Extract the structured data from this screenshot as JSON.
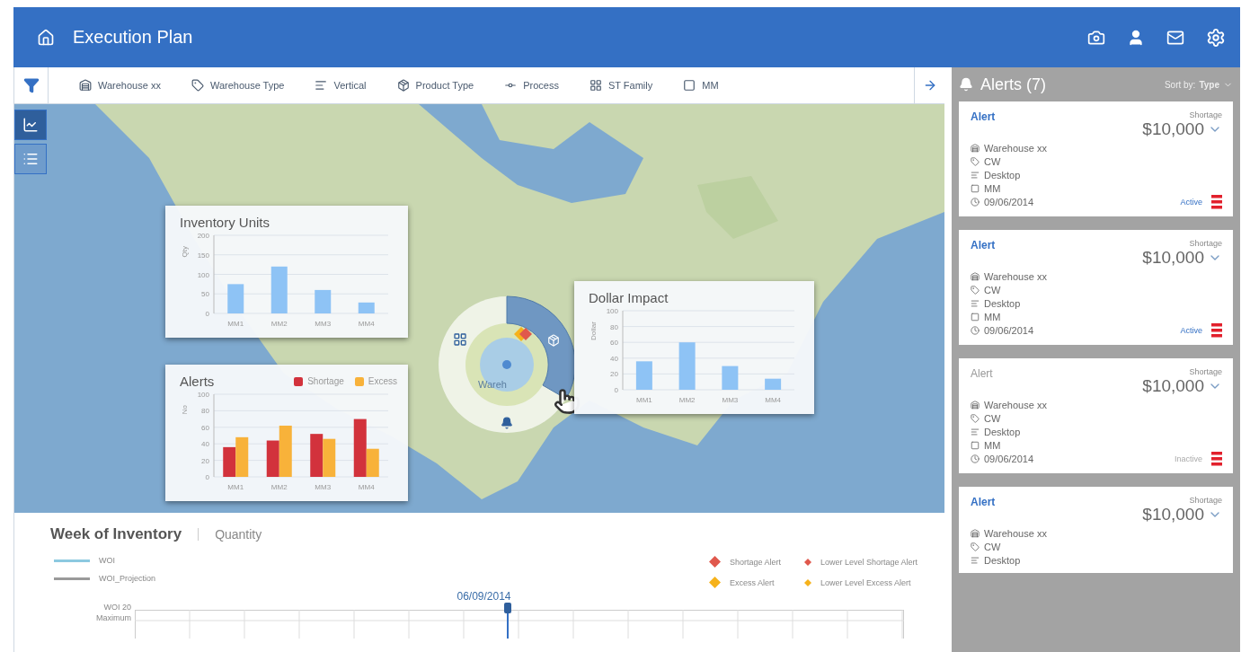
{
  "header": {
    "title": "Execution Plan"
  },
  "filters": [
    {
      "kind": "warehouse",
      "label": "Warehouse xx"
    },
    {
      "kind": "type",
      "label": "Warehouse Type"
    },
    {
      "kind": "vertical",
      "label": "Vertical"
    },
    {
      "kind": "product",
      "label": "Product Type"
    },
    {
      "kind": "process",
      "label": "Process"
    },
    {
      "kind": "family",
      "label": "ST Family"
    },
    {
      "kind": "mm",
      "label": "MM"
    }
  ],
  "view_tools": [
    {
      "kind": "chart",
      "selected": true
    },
    {
      "kind": "list",
      "selected": false
    }
  ],
  "map": {
    "radial_label": "Wareh",
    "inventory": {
      "chart_data": {
        "type": "bar",
        "title": "Inventory Units",
        "ylabel": "Qty",
        "categories": [
          "MM1",
          "MM2",
          "MM3",
          "MM4"
        ],
        "series": [
          {
            "color": "#8ec3f5",
            "values": [
              75,
              120,
              60,
              28
            ]
          }
        ],
        "grid": true,
        "ylim": [
          0,
          200
        ],
        "yticks": [
          0,
          50,
          100,
          150,
          200
        ]
      }
    },
    "alerts": {
      "chart_data": {
        "type": "bar",
        "title": "Alerts",
        "ylabel": "No",
        "categories": [
          "MM1",
          "MM2",
          "MM3",
          "MM4"
        ],
        "series": [
          {
            "name": "Shortage",
            "color": "#d2323c",
            "values": [
              36,
              44,
              52,
              70
            ]
          },
          {
            "name": "Excess",
            "color": "#f8b23a",
            "values": [
              48,
              62,
              46,
              34
            ]
          }
        ],
        "grid": true,
        "ylim": [
          0,
          100
        ],
        "yticks": [
          0,
          20,
          40,
          60,
          80,
          100
        ]
      }
    },
    "dollar": {
      "chart_data": {
        "type": "bar",
        "title": "Dollar Impact",
        "ylabel": "Dollar",
        "categories": [
          "MM1",
          "MM2",
          "MM3",
          "MM4"
        ],
        "series": [
          {
            "color": "#8ec3f5",
            "values": [
              36,
              60,
              30,
              14
            ]
          }
        ],
        "grid": true,
        "ylim": [
          0,
          100
        ],
        "yticks": [
          0,
          20,
          40,
          60,
          80,
          100
        ]
      }
    }
  },
  "bottom": {
    "tabs": [
      {
        "label": "Week of Inventory",
        "selected": true
      },
      {
        "label": "Quantity",
        "selected": false
      }
    ],
    "lines": [
      {
        "label": "WOI",
        "color": "#8cc9e0"
      },
      {
        "label": "WOI_Projection",
        "color": "#9a9a9a"
      }
    ],
    "markers": [
      {
        "label": "Shortage Alert",
        "kind": "major",
        "color": "#e0584c"
      },
      {
        "label": "Lower Level Shortage Alert",
        "kind": "minor",
        "color": "#e0584c"
      },
      {
        "label": "Excess Alert",
        "kind": "major",
        "color": "#f6b21b"
      },
      {
        "label": "Lower Level Excess Alert",
        "kind": "minor",
        "color": "#f6b21b"
      }
    ],
    "date": "06/09/2014",
    "ylabel": "WOI",
    "tick": "20",
    "level_label": "Maximum"
  },
  "alerts_panel": {
    "title": "Alerts (7)",
    "sort_label": "Sort by:",
    "sort_value": "Type",
    "cards": [
      {
        "title": "Alert",
        "active": true,
        "type": "Shortage",
        "amount": "$10,000",
        "details": [
          {
            "kind": "warehouse",
            "text": "Warehouse xx"
          },
          {
            "kind": "type",
            "text": "CW"
          },
          {
            "kind": "vertical",
            "text": "Desktop"
          },
          {
            "kind": "mm",
            "text": "MM"
          },
          {
            "kind": "date",
            "text": "09/06/2014"
          }
        ],
        "status": "Active"
      },
      {
        "title": "Alert",
        "active": true,
        "type": "Shortage",
        "amount": "$10,000",
        "details": [
          {
            "kind": "warehouse",
            "text": "Warehouse xx"
          },
          {
            "kind": "type",
            "text": "CW"
          },
          {
            "kind": "vertical",
            "text": "Desktop"
          },
          {
            "kind": "mm",
            "text": "MM"
          },
          {
            "kind": "date",
            "text": "09/06/2014"
          }
        ],
        "status": "Active"
      },
      {
        "title": "Alert",
        "active": false,
        "type": "Shortage",
        "amount": "$10,000",
        "details": [
          {
            "kind": "warehouse",
            "text": "Warehouse xx"
          },
          {
            "kind": "type",
            "text": "CW"
          },
          {
            "kind": "vertical",
            "text": "Desktop"
          },
          {
            "kind": "mm",
            "text": "MM"
          },
          {
            "kind": "date",
            "text": "09/06/2014"
          }
        ],
        "status": "Inactive"
      },
      {
        "title": "Alert",
        "active": true,
        "type": "Shortage",
        "amount": "$10,000",
        "details": [
          {
            "kind": "warehouse",
            "text": "Warehouse xx"
          },
          {
            "kind": "type",
            "text": "CW"
          },
          {
            "kind": "vertical",
            "text": "Desktop"
          }
        ]
      }
    ]
  }
}
